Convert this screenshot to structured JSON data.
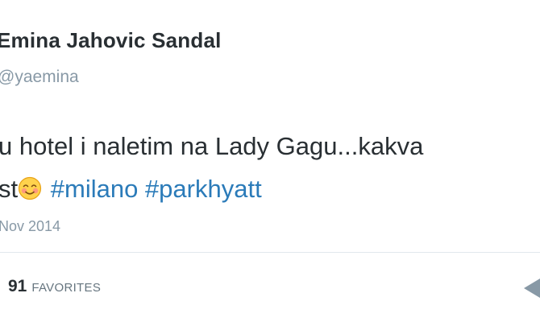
{
  "tweet": {
    "display_name": "Emina Jahovic Sandal",
    "handle": "@yaemina",
    "text_line1": "u hotel i naletim na Lady Gagu...kakva",
    "text_line2_prefix": "st",
    "emoji": "smiling-face-with-smiling-eyes",
    "hashtags": [
      "#milano",
      "#parkhyatt"
    ],
    "timestamp": "Nov 2014"
  },
  "stats": {
    "favorites_count": "91",
    "favorites_label": "FAVORITES"
  },
  "colors": {
    "text": "#292f33",
    "muted": "#8899a6",
    "hashtag": "#2b7bb9",
    "divider": "#e1e8ed"
  }
}
